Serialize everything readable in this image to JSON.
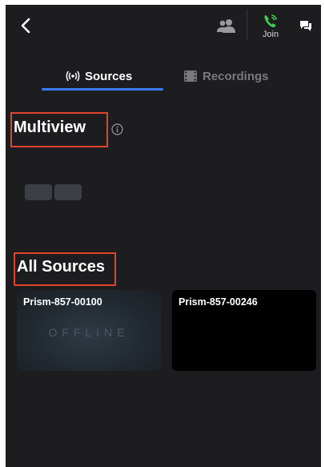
{
  "header": {
    "join_label": "Join"
  },
  "tabs": [
    {
      "label": "Sources",
      "active": true
    },
    {
      "label": "Recordings",
      "active": false
    }
  ],
  "multiview": {
    "title": "Multiview"
  },
  "all_sources": {
    "title": "All Sources",
    "cards": [
      {
        "name": "Prism-857-00100",
        "status": "OFFLINE"
      },
      {
        "name": "Prism-857-00246"
      }
    ]
  },
  "colors": {
    "background": "#1d1d1f",
    "accent": "#3a7bff",
    "join_icon": "#3ccf4e",
    "annotation_box": "#e0442e"
  },
  "icons": [
    "back-arrow-icon",
    "people-icon",
    "phone-join-icon",
    "chat-icon",
    "broadcast-icon",
    "film-icon",
    "info-icon"
  ]
}
